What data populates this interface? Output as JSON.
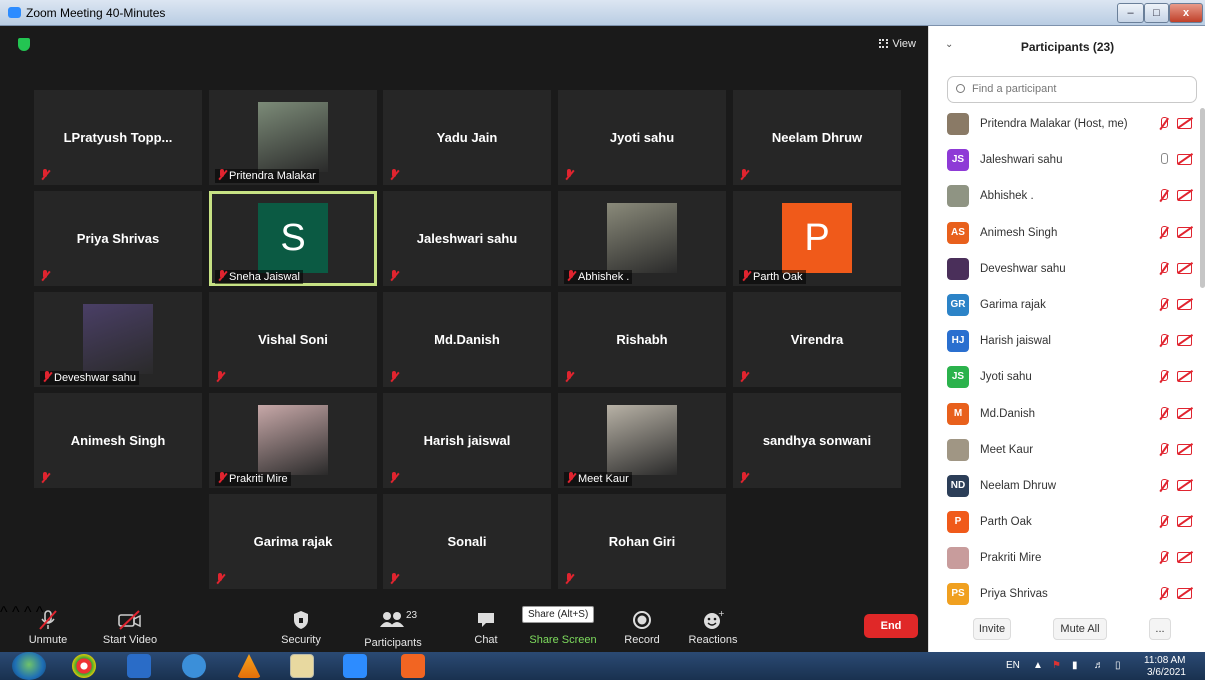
{
  "window": {
    "title": "Zoom Meeting 40-Minutes",
    "min": "–",
    "max": "□",
    "close": "x"
  },
  "meeting": {
    "view_label": "View"
  },
  "tiles": [
    {
      "name": "LPratyush  Topp...",
      "kind": "text",
      "label": ""
    },
    {
      "name": "",
      "kind": "photo",
      "label": "Pritendra Malakar",
      "photo_color": "#7c8b78"
    },
    {
      "name": "Yadu Jain",
      "kind": "text",
      "label": ""
    },
    {
      "name": "Jyoti sahu",
      "kind": "text",
      "label": ""
    },
    {
      "name": "Neelam Dhruw",
      "kind": "text",
      "label": ""
    },
    {
      "name": "Priya Shrivas",
      "kind": "text",
      "label": ""
    },
    {
      "name": "",
      "kind": "avatar",
      "label": "Sneha Jaiswal",
      "letter": "S",
      "color": "#0b5a43",
      "active": true
    },
    {
      "name": "Jaleshwari sahu",
      "kind": "text",
      "label": ""
    },
    {
      "name": "",
      "kind": "photo",
      "label": "Abhishek .",
      "photo_color": "#8a8a7a"
    },
    {
      "name": "",
      "kind": "avatar",
      "label": "Parth Oak",
      "letter": "P",
      "color": "#f05a1a"
    },
    {
      "name": "",
      "kind": "photo",
      "label": "Deveshwar sahu",
      "photo_color": "#4a3f66"
    },
    {
      "name": "Vishal Soni",
      "kind": "text",
      "label": ""
    },
    {
      "name": "Md.Danish",
      "kind": "text",
      "label": ""
    },
    {
      "name": "Rishabh",
      "kind": "text",
      "label": ""
    },
    {
      "name": "Virendra",
      "kind": "text",
      "label": ""
    },
    {
      "name": "Animesh Singh",
      "kind": "text",
      "label": ""
    },
    {
      "name": "",
      "kind": "photo",
      "label": "Prakriti Mire",
      "photo_color": "#c7a8a8"
    },
    {
      "name": "Harish jaiswal",
      "kind": "text",
      "label": ""
    },
    {
      "name": "",
      "kind": "photo",
      "label": "Meet Kaur",
      "photo_color": "#b8b2a6"
    },
    {
      "name": "sandhya sonwani",
      "kind": "text",
      "label": ""
    },
    {
      "name": "Garima rajak",
      "kind": "text",
      "label": ""
    },
    {
      "name": "Sonali",
      "kind": "text",
      "label": ""
    },
    {
      "name": "Rohan Giri",
      "kind": "text",
      "label": ""
    }
  ],
  "toolbar": {
    "unmute": "Unmute",
    "start_video": "Start Video",
    "security": "Security",
    "participants": "Participants",
    "participants_count": "23",
    "chat": "Chat",
    "share_screen": "Share Screen",
    "share_tooltip": "Share (Alt+S)",
    "record": "Record",
    "reactions": "Reactions",
    "end": "End"
  },
  "panel": {
    "title": "Participants (23)",
    "search_placeholder": "Find a participant",
    "invite": "Invite",
    "mute_all": "Mute All",
    "more": "..."
  },
  "participants": [
    {
      "name": "Pritendra Malakar (Host, me)",
      "initials": "",
      "color": "#8a7a66",
      "mic_on": false
    },
    {
      "name": "Jaleshwari sahu",
      "initials": "JS",
      "color": "#8e3ad6",
      "mic_on": true
    },
    {
      "name": "Abhishek .",
      "initials": "",
      "color": "#8f9483",
      "mic_on": false
    },
    {
      "name": "Animesh Singh",
      "initials": "AS",
      "color": "#e8601c",
      "mic_on": false
    },
    {
      "name": "Deveshwar sahu",
      "initials": "",
      "color": "#4a2f5a",
      "mic_on": false
    },
    {
      "name": "Garima rajak",
      "initials": "GR",
      "color": "#2c83c7",
      "mic_on": false
    },
    {
      "name": "Harish jaiswal",
      "initials": "HJ",
      "color": "#2a6fcf",
      "mic_on": false
    },
    {
      "name": "Jyoti sahu",
      "initials": "JS",
      "color": "#2bb24c",
      "mic_on": false
    },
    {
      "name": "Md.Danish",
      "initials": "M",
      "color": "#e8601c",
      "mic_on": false
    },
    {
      "name": "Meet Kaur",
      "initials": "",
      "color": "#a09684",
      "mic_on": false
    },
    {
      "name": "Neelam Dhruw",
      "initials": "ND",
      "color": "#2c3e58",
      "mic_on": false
    },
    {
      "name": "Parth Oak",
      "initials": "P",
      "color": "#f05a1a",
      "mic_on": false
    },
    {
      "name": "Prakriti Mire",
      "initials": "",
      "color": "#c89c9c",
      "mic_on": false
    },
    {
      "name": "Priya Shrivas",
      "initials": "PS",
      "color": "#f0a020",
      "mic_on": false
    }
  ],
  "taskbar": {
    "lang": "EN",
    "time": "11:08 AM",
    "date": "3/6/2021"
  },
  "colors": {
    "accent": "#2d8cff",
    "end": "#e02828",
    "muted": "#e0242f",
    "active_tile": "#c7e284"
  }
}
